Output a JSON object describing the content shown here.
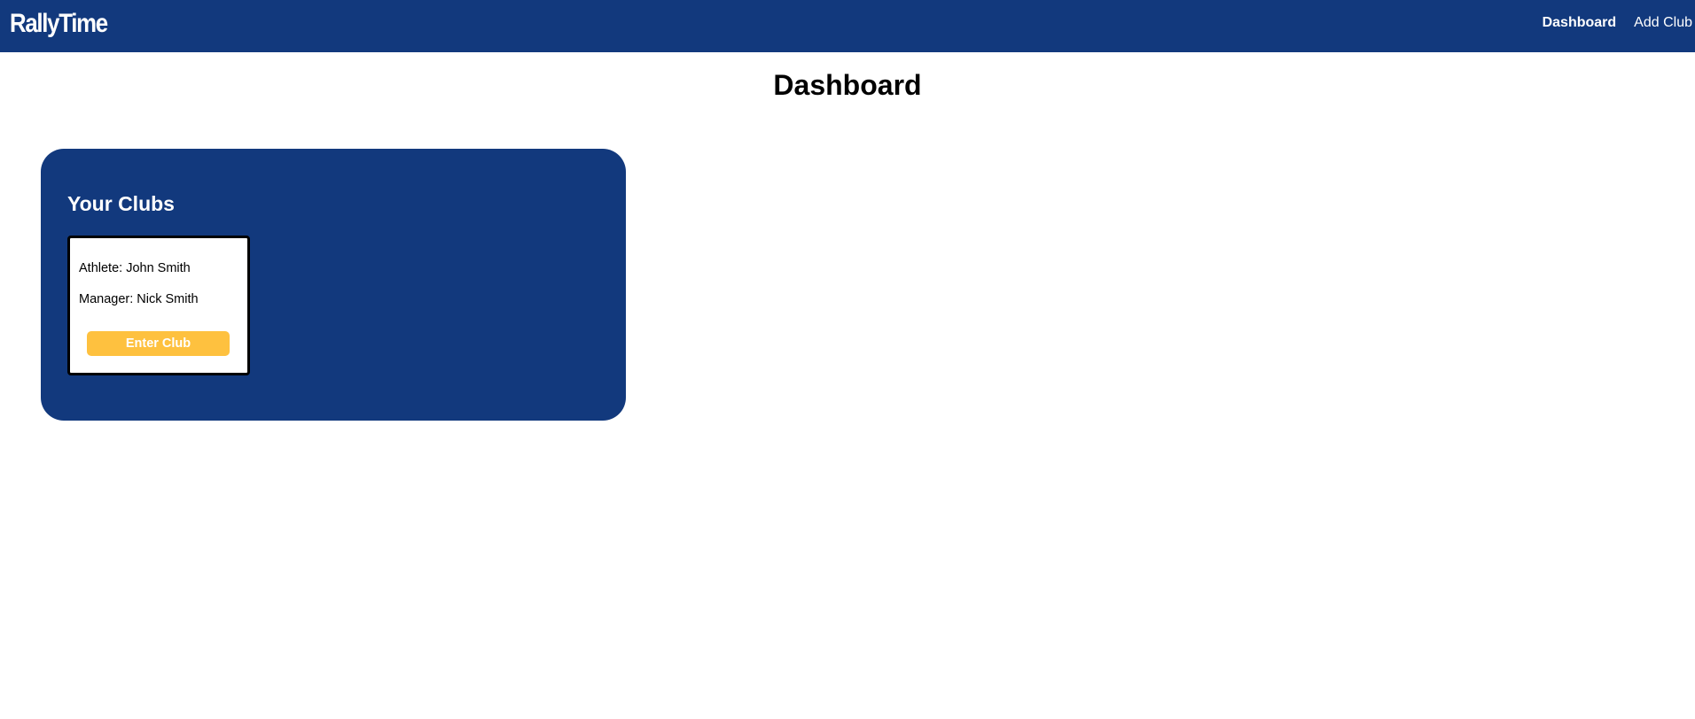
{
  "navbar": {
    "brand": "RallyTime",
    "links": [
      {
        "label": "Dashboard",
        "active": true
      },
      {
        "label": "Add Club",
        "active": false
      }
    ],
    "background": "#12397d"
  },
  "main": {
    "title": "Dashboard",
    "clubs_panel": {
      "heading": "Your Clubs",
      "clubs": [
        {
          "athlete": "Athlete: John Smith",
          "manager": "Manager: Nick Smith",
          "button_label": "Enter Club"
        }
      ]
    }
  },
  "colors": {
    "primary": "#12397d",
    "accent": "#fec13f",
    "text": "#000000",
    "background": "#ffffff"
  }
}
